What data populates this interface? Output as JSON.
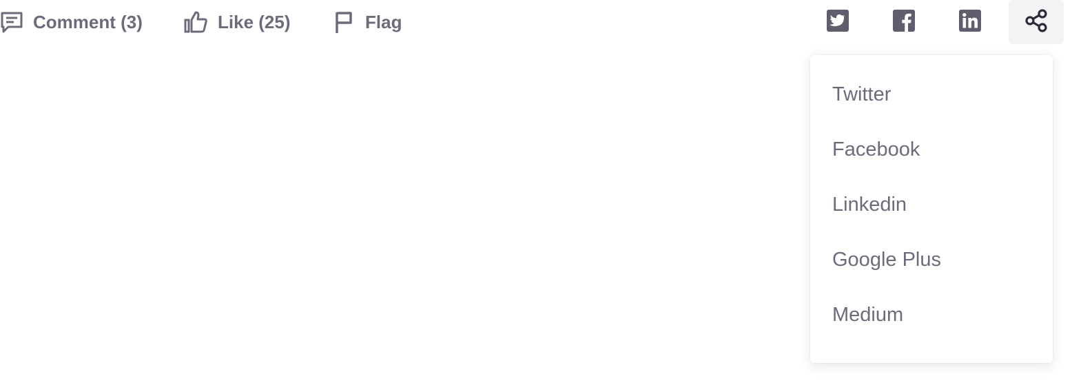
{
  "actions": {
    "comment": {
      "label": "Comment (3)",
      "icon": "comment-icon"
    },
    "like": {
      "label": "Like (25)",
      "icon": "thumbs-up-icon"
    },
    "flag": {
      "label": "Flag",
      "icon": "flag-icon"
    }
  },
  "social": [
    {
      "icon": "twitter-icon"
    },
    {
      "icon": "facebook-icon"
    },
    {
      "icon": "linkedin-icon"
    },
    {
      "icon": "share-icon",
      "active": true
    }
  ],
  "share_menu": {
    "items": [
      "Twitter",
      "Facebook",
      "Linkedin",
      "Google Plus",
      "Medium"
    ]
  },
  "colors": {
    "text": "#6b6b7b",
    "icon": "#5e5e6e",
    "active_bg": "#f3f4f6",
    "share_icon": "#2b2b3b"
  }
}
